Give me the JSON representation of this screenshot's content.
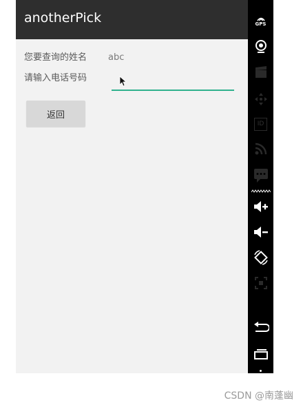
{
  "app": {
    "title": "anotherPick"
  },
  "form": {
    "name_label": "您要查询的姓名",
    "name_value": "abc",
    "phone_label": "请输入电话号码",
    "phone_value": ""
  },
  "back_button": {
    "label": "返回"
  },
  "right_toolbar": {
    "gps_label": "GPS",
    "id_label": "ID",
    "icons": [
      "gps-icon",
      "webcam-icon",
      "clapper-icon",
      "dpad-icon",
      "id-icon",
      "rss-icon",
      "sms-icon",
      "volume-up-icon",
      "volume-down-icon",
      "rotate-icon",
      "resize-icon",
      "back-icon",
      "recent-apps-icon"
    ]
  },
  "watermark": {
    "text": "CSDN @南蓬幽"
  },
  "colors": {
    "action_bar": "#2e2e2e",
    "accent": "#2fb18d",
    "background": "#f2f2f2",
    "side_bar": "#000000"
  }
}
